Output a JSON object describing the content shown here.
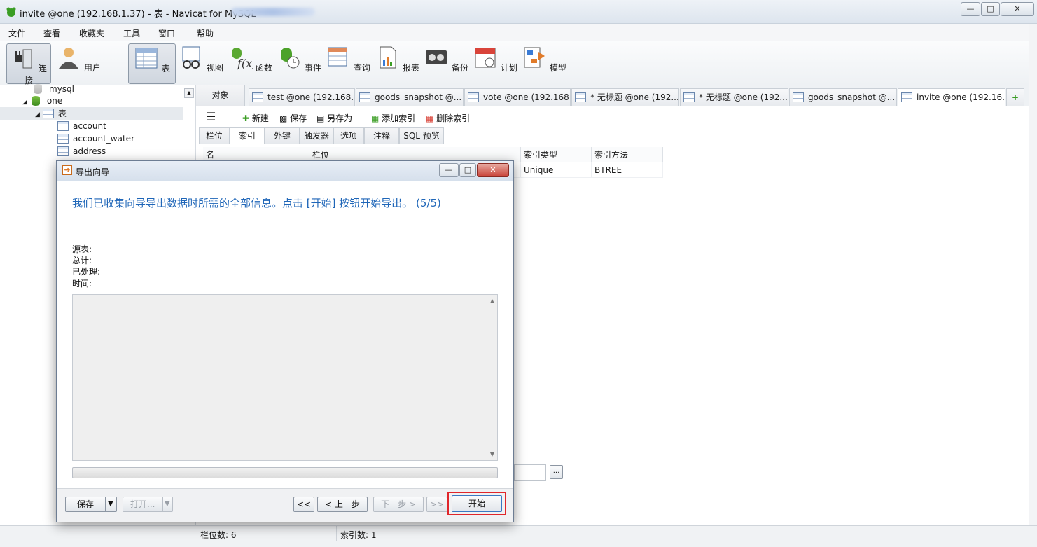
{
  "window": {
    "title": "invite @one (192.168.1.37) - 表 - Navicat for MySQL"
  },
  "menu": [
    "文件",
    "查看",
    "收藏夹",
    "工具",
    "窗口",
    "帮助"
  ],
  "toolbar": [
    "连接",
    "用户",
    "表",
    "视图",
    "函数",
    "事件",
    "查询",
    "报表",
    "备份",
    "计划",
    "模型"
  ],
  "tree": {
    "mysql": "mysql",
    "one": "one",
    "tables_group": "表",
    "tables": [
      "account",
      "account_water",
      "address"
    ]
  },
  "tabs": {
    "objects": "对象",
    "docs": [
      "test @one (192.168....",
      "goods_snapshot @...",
      "vote @one (192.168....",
      "* 无标题 @one (192....",
      "* 无标题 @one (192....",
      "goods_snapshot @...",
      "invite @one (192.16..."
    ]
  },
  "subtoolbar": {
    "new": "新建",
    "save": "保存",
    "save_as": "另存为",
    "add_index": "添加索引",
    "delete_index": "删除索引"
  },
  "design_tabs": [
    "栏位",
    "索引",
    "外键",
    "触发器",
    "选项",
    "注释",
    "SQL 预览"
  ],
  "grid": {
    "headers": [
      "名",
      "栏位",
      "索引类型",
      "索引方法"
    ],
    "row": {
      "type": "Unique",
      "method": "BTREE"
    }
  },
  "status": {
    "fields": "栏位数: 6",
    "indexes": "索引数: 1"
  },
  "dialog": {
    "title": "导出向导",
    "heading": "我们已收集向导导出数据时所需的全部信息。点击 [开始] 按钮开始导出。 (5/5)",
    "labels": {
      "source": "源表:",
      "total": "总计:",
      "processed": "已处理:",
      "time": "时间:"
    },
    "buttons": {
      "save": "保存",
      "open": "打开...",
      "first": "<<",
      "prev": "< 上一步",
      "next": "下一步 >",
      "last": ">>",
      "start": "开始"
    }
  },
  "colors": {
    "accent": "#1f66b8",
    "highlight": "#e0262b"
  }
}
